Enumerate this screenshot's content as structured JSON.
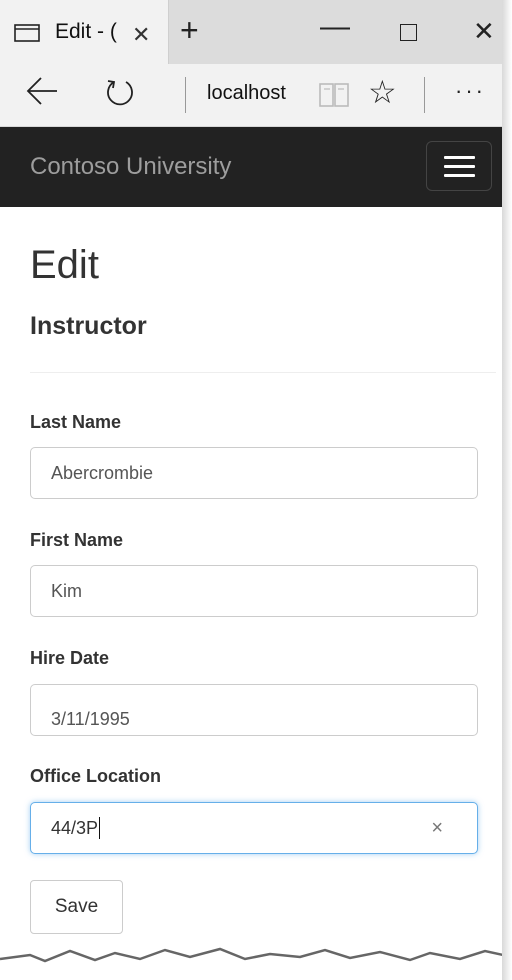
{
  "browser": {
    "tab_title": "Edit - (",
    "url": "localhost",
    "icons": {
      "tab": "tab-page-icon",
      "close_tab": "close-icon",
      "new_tab": "plus-icon",
      "minimize": "minimize-icon",
      "maximize": "maximize-icon",
      "close_window": "close-icon",
      "back": "back-arrow-icon",
      "refresh": "refresh-icon",
      "reading_view": "book-icon",
      "favorite": "star-icon",
      "more": "ellipsis-icon"
    },
    "glyphs": {
      "close_tab": "✕",
      "new_tab": "+",
      "minimize": "—",
      "close_window": "✕",
      "favorite": "☆",
      "more": "···"
    }
  },
  "navbar": {
    "brand": "Contoso University"
  },
  "page": {
    "title": "Edit",
    "subtitle": "Instructor"
  },
  "form": {
    "last_name": {
      "label": "Last Name",
      "value": "Abercrombie"
    },
    "first_name": {
      "label": "First Name",
      "value": "Kim"
    },
    "hire_date": {
      "label": "Hire Date",
      "value": "3/11/1995"
    },
    "office_location": {
      "label": "Office Location",
      "value": "44/3P",
      "clear_glyph": "×"
    },
    "save_label": "Save"
  },
  "colors": {
    "navbar_bg": "#222222",
    "brand_text": "#9d9d9d",
    "focus_border": "#66afe9"
  }
}
